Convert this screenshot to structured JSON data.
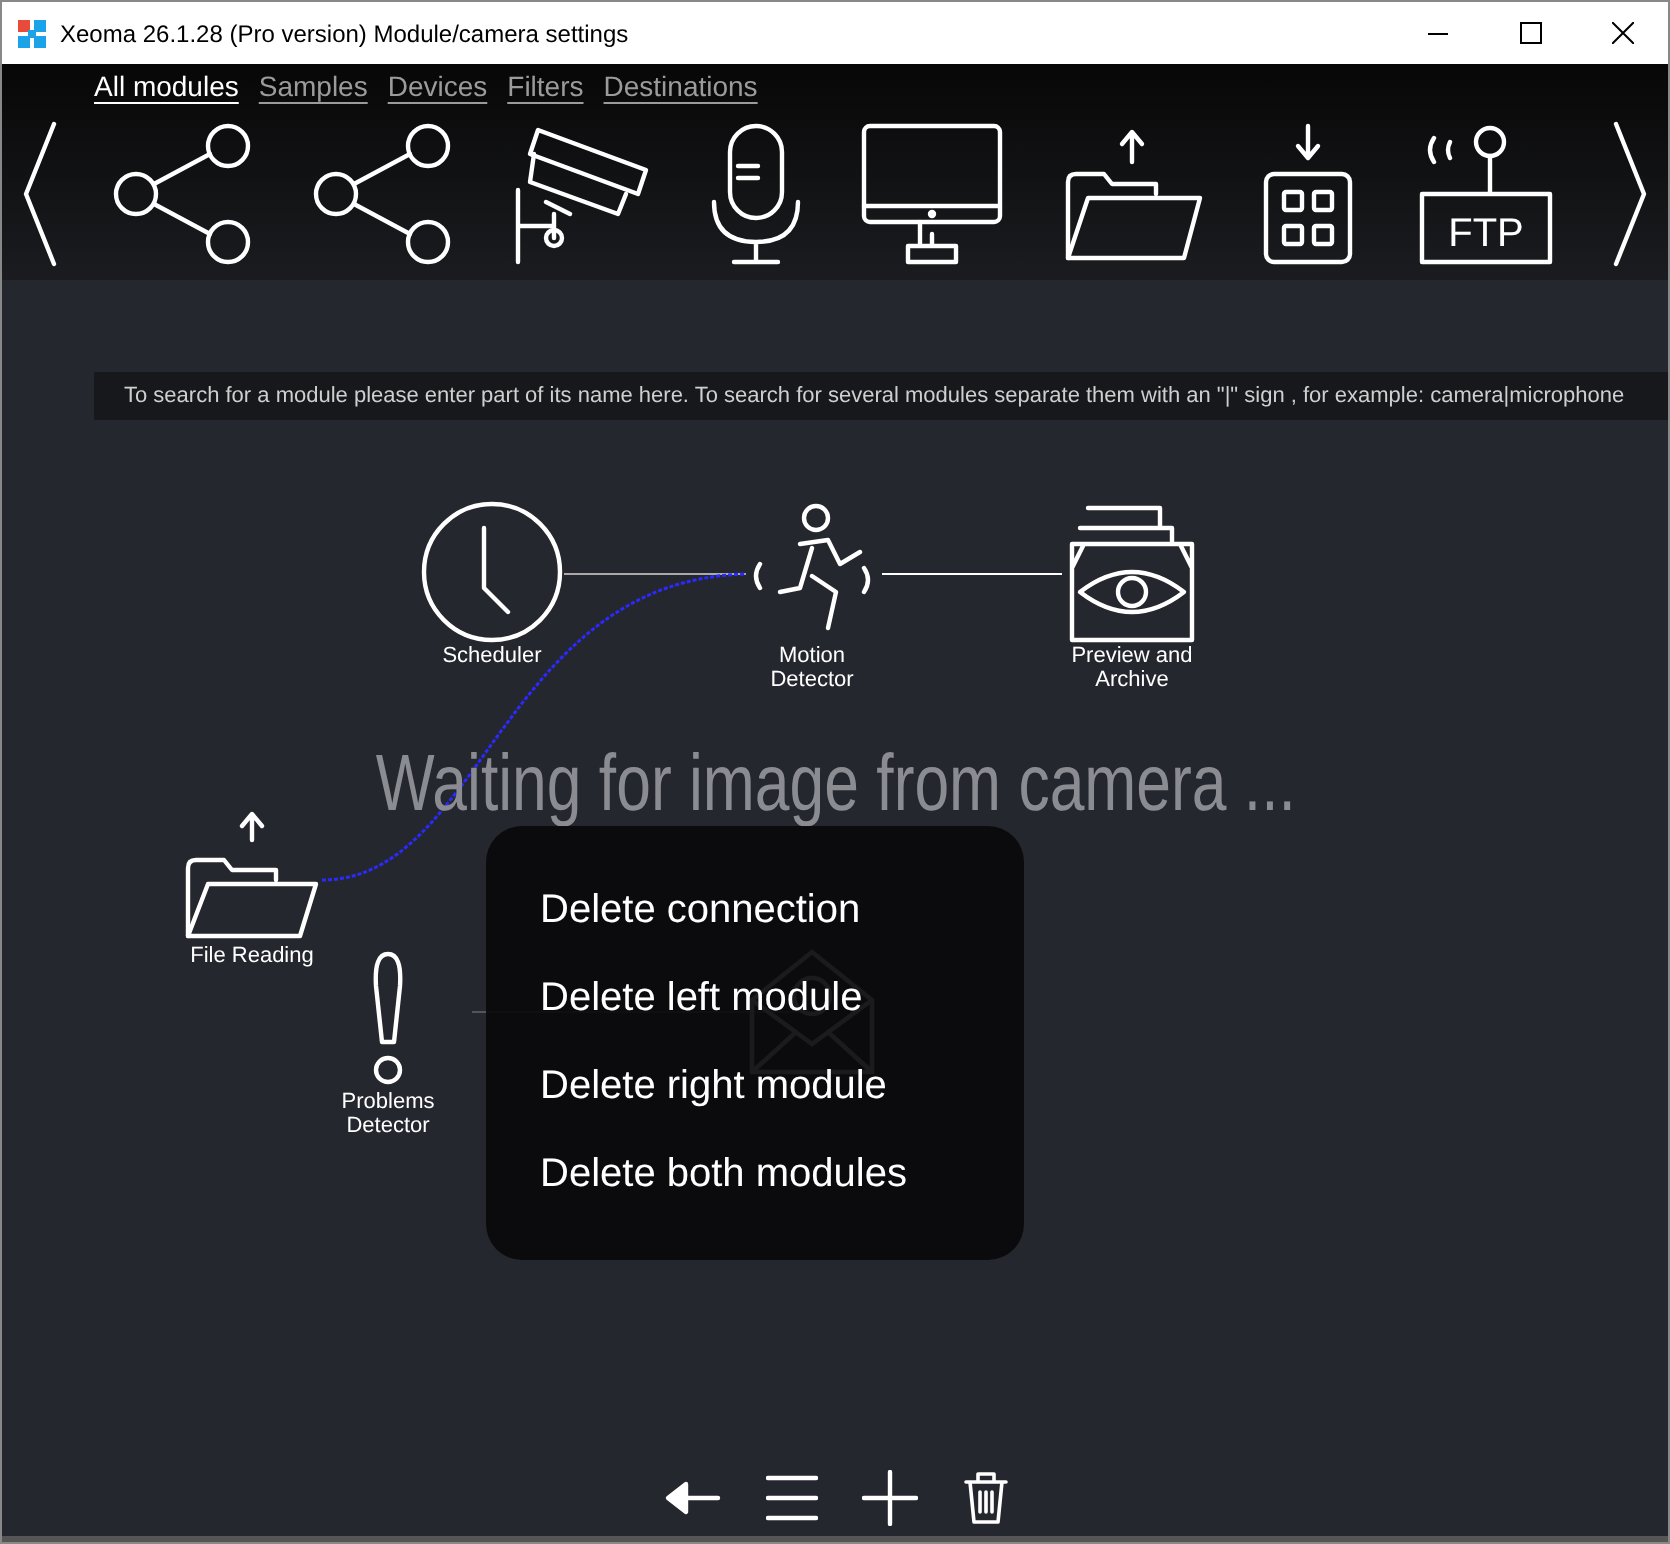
{
  "window": {
    "title": "Xeoma 26.1.28 (Pro version) Module/camera settings"
  },
  "tabs": [
    {
      "label": "All modules",
      "selected": true
    },
    {
      "label": "Samples",
      "selected": false
    },
    {
      "label": "Devices",
      "selected": false
    },
    {
      "label": "Filters",
      "selected": false
    },
    {
      "label": "Destinations",
      "selected": false
    }
  ],
  "module_bar": {
    "ftp_label": "FTP"
  },
  "search": {
    "placeholder": "To search for a module please enter part of its name here. To search for several modules separate them with an \"|\" sign , for example: camera|microphone"
  },
  "status": "Waiting for image from camera ...",
  "nodes": [
    {
      "kind": "clock",
      "label": "Scheduler"
    },
    {
      "kind": "runner",
      "label": "Motion Detector"
    },
    {
      "kind": "archive",
      "label": "Preview and Archive"
    },
    {
      "kind": "folder",
      "label": "File Reading"
    },
    {
      "kind": "alert",
      "label": "Problems Detector"
    },
    {
      "kind": "envelope"
    }
  ],
  "context_menu": [
    "Delete connection",
    "Delete left module",
    "Delete right module",
    "Delete both modules"
  ]
}
